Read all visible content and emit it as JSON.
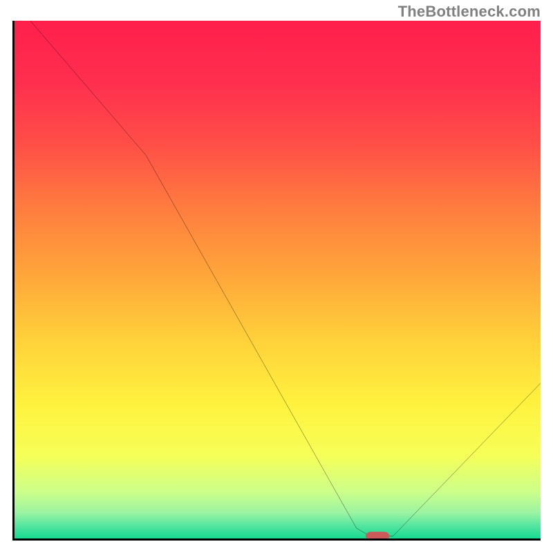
{
  "watermark": "TheBottleneck.com",
  "chart_data": {
    "type": "line",
    "title": "",
    "xlabel": "",
    "ylabel": "",
    "xlim": [
      0,
      100
    ],
    "ylim": [
      0,
      100
    ],
    "x": [
      3,
      25,
      65,
      67.5,
      72,
      100
    ],
    "values": [
      100,
      74,
      2,
      0.5,
      0.5,
      30
    ],
    "marker": {
      "x": 69,
      "y": 0.5,
      "color": "#cc5a5a",
      "shape": "pill"
    },
    "background_gradient_stops": [
      {
        "pos": 0.0,
        "color": "#ff1f4b"
      },
      {
        "pos": 0.12,
        "color": "#ff2f4f"
      },
      {
        "pos": 0.24,
        "color": "#ff4f47"
      },
      {
        "pos": 0.36,
        "color": "#ff7c3f"
      },
      {
        "pos": 0.5,
        "color": "#ffa93a"
      },
      {
        "pos": 0.62,
        "color": "#ffd23a"
      },
      {
        "pos": 0.74,
        "color": "#fff23e"
      },
      {
        "pos": 0.84,
        "color": "#f6ff58"
      },
      {
        "pos": 0.91,
        "color": "#ccff8a"
      },
      {
        "pos": 0.95,
        "color": "#9cf4a2"
      },
      {
        "pos": 0.975,
        "color": "#55e6a0"
      },
      {
        "pos": 1.0,
        "color": "#17da91"
      }
    ],
    "grid": false,
    "legend": false
  }
}
